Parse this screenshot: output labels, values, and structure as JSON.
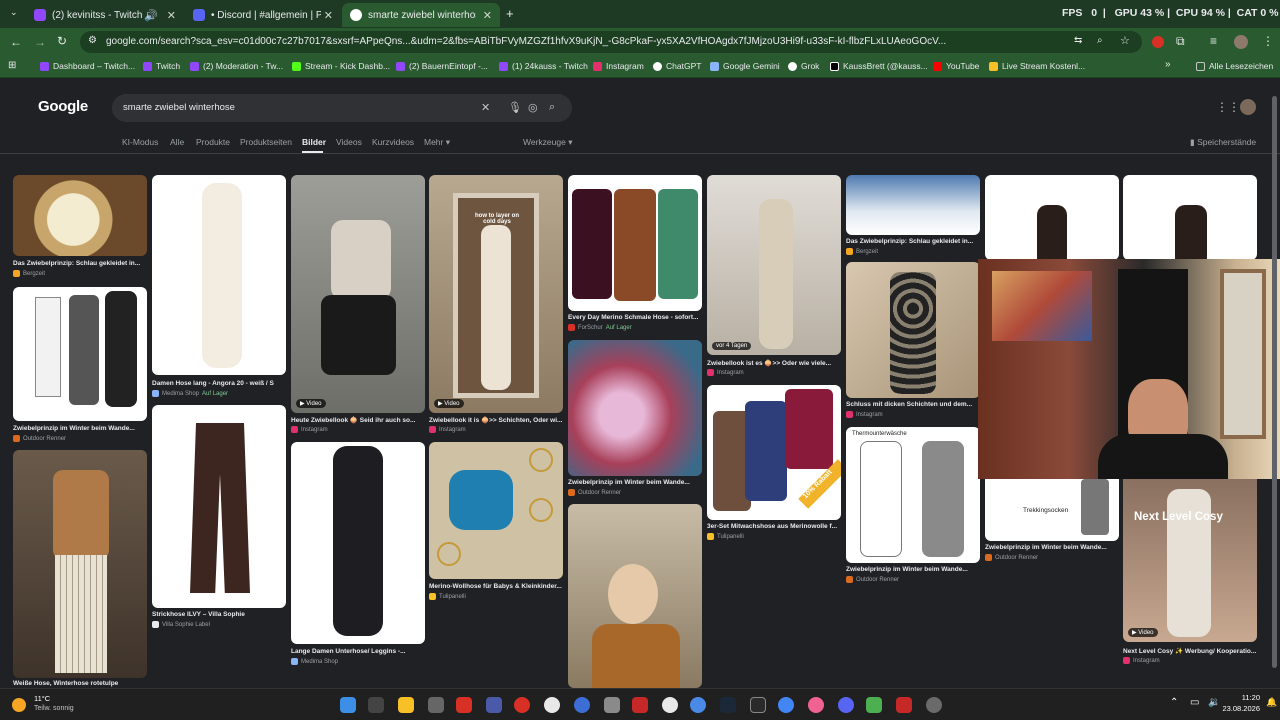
{
  "tabs": [
    {
      "title": "(2) kevinitss - Twitch",
      "color": "#9146ff"
    },
    {
      "title": "• Discord | #allgemein | Posching",
      "color": "#5865f2"
    },
    {
      "title": "smarte zwiebel winterhose - Google",
      "color": "#4285f4"
    }
  ],
  "stats": {
    "fps_label": "FPS",
    "fps_value": "0",
    "gpu_label": "GPU",
    "gpu_value": "43 %",
    "cpu_label": "CPU",
    "cpu_value": "94 %",
    "extra": "CAT 0 %"
  },
  "address": {
    "url": "google.com/search?sca_esv=c01d00c7c27b7017&sxsrf=APpeQns...&udm=2&fbs=ABiTbFVyMZGZf1hfvX9uKjN_-G8cPkaF-yx5XA2VfHOAgdx7fJMjzoU3Hi9f-u33sF-kI-flbzFLxLUAeoGOcV..."
  },
  "bookmarks": [
    {
      "label": "Dashboard – Twitch...",
      "color": "#9146ff"
    },
    {
      "label": "Twitch",
      "color": "#9146ff"
    },
    {
      "label": "(2) Moderation - Tw...",
      "color": "#9146ff"
    },
    {
      "label": "Stream - Kick Dashb...",
      "color": "#53fc18"
    },
    {
      "label": "(2) BauernEintopf -...",
      "color": "#9146ff"
    },
    {
      "label": "(1) 24kauss - Twitch",
      "color": "#9146ff"
    },
    {
      "label": "Instagram",
      "color": "#e1306c"
    },
    {
      "label": "ChatGPT",
      "color": "#ffffff"
    },
    {
      "label": "Google Gemini",
      "color": "#8ab4f8"
    },
    {
      "label": "Grok",
      "color": "#ffffff"
    },
    {
      "label": "KaussBrett (@kauss...",
      "color": "#ffffff"
    },
    {
      "label": "YouTube",
      "color": "#ff0000"
    },
    {
      "label": "Live Stream Kostenl...",
      "color": "#f6c026"
    },
    {
      "label": "Alle Lesezeichen",
      "color": "#c4c7c5"
    }
  ],
  "google": {
    "logo": "Google",
    "query": "smarte zwiebel winterhose",
    "nav": [
      "KI-Modus",
      "Alle",
      "Produkte",
      "Produktseiten",
      "Bilder",
      "Videos",
      "Kurzvideos",
      "Mehr",
      "Werkzeuge"
    ],
    "active_nav": "Bilder",
    "saved": "Speicherstände"
  },
  "results": [
    {
      "caption": "Das Zwiebelprinzip: Schlau gekleidet in...",
      "source": "Bergzeit"
    },
    {
      "caption": "Zwiebelprinzip im Winter beim Wande...",
      "source": "Outdoor Renner"
    },
    {
      "caption": "Weiße Hose, Winterhose rotetulpe",
      "source": ""
    },
    {
      "caption": "Damen Hose lang - Angora 20 - weiß / S",
      "source": "Medima Shop",
      "stock": "Auf Lager"
    },
    {
      "caption": "Strickhose ILVY – Villa Sophie",
      "source": "Villa Sophie Label"
    },
    {
      "caption": "Heute Zwiebellook 🧅 Seid ihr auch so...",
      "source": "Instagram",
      "badge": "Video"
    },
    {
      "caption": "Lange Damen Unterhose/ Leggins -...",
      "source": "Medima Shop"
    },
    {
      "caption": "Zwiebellook it is 🧅>> Schichten, Oder wi...",
      "source": "Instagram",
      "badge": "Video",
      "overlay": "how to layer on cold days"
    },
    {
      "caption": "Merino-Wollhose für Babys & Kleinkinder...",
      "source": "Tulipanelli"
    },
    {
      "caption": "Every Day Merino Schmale Hose - sofort...",
      "source": "ForSchur",
      "stock": "Auf Lager"
    },
    {
      "caption": "Zwiebelprinzip im Winter beim Wande...",
      "source": "Outdoor Renner"
    },
    {
      "caption": "Zwiebellook ist es 🧅>> Oder wie viele...",
      "source": "Instagram",
      "badge": "vor 4 Tagen"
    },
    {
      "caption": "3er-Set Mitwachshose aus Merinowolle f...",
      "source": "Tulipanelli",
      "overlay": "10% Rabatt"
    },
    {
      "caption": "Das Zwiebelprinzip: Schlau gekleidet in...",
      "source": "Bergzeit"
    },
    {
      "caption": "Schluss mit dicken Schichten und dem...",
      "source": "Instagram"
    },
    {
      "caption": "Zwiebelprinzip im Winter beim Wande...",
      "source": "Outdoor Renner",
      "overlay": "Thermounterwäsche"
    },
    {
      "caption": "Zwiebelprinzip im Winter beim Wande...",
      "source": "Outdoor Renner",
      "overlay": "Trekkingsocken"
    },
    {
      "caption": "Next Level Cosy ✨ Werbung/ Kooperatio...",
      "source": "Instagram",
      "badge": "Video",
      "overlay": "Next Level Cosy"
    }
  ],
  "taskbar": {
    "weather_temp": "11°C",
    "weather_desc": "Teilw. sonnig",
    "time": "11:20",
    "date": "23.08.2026"
  }
}
